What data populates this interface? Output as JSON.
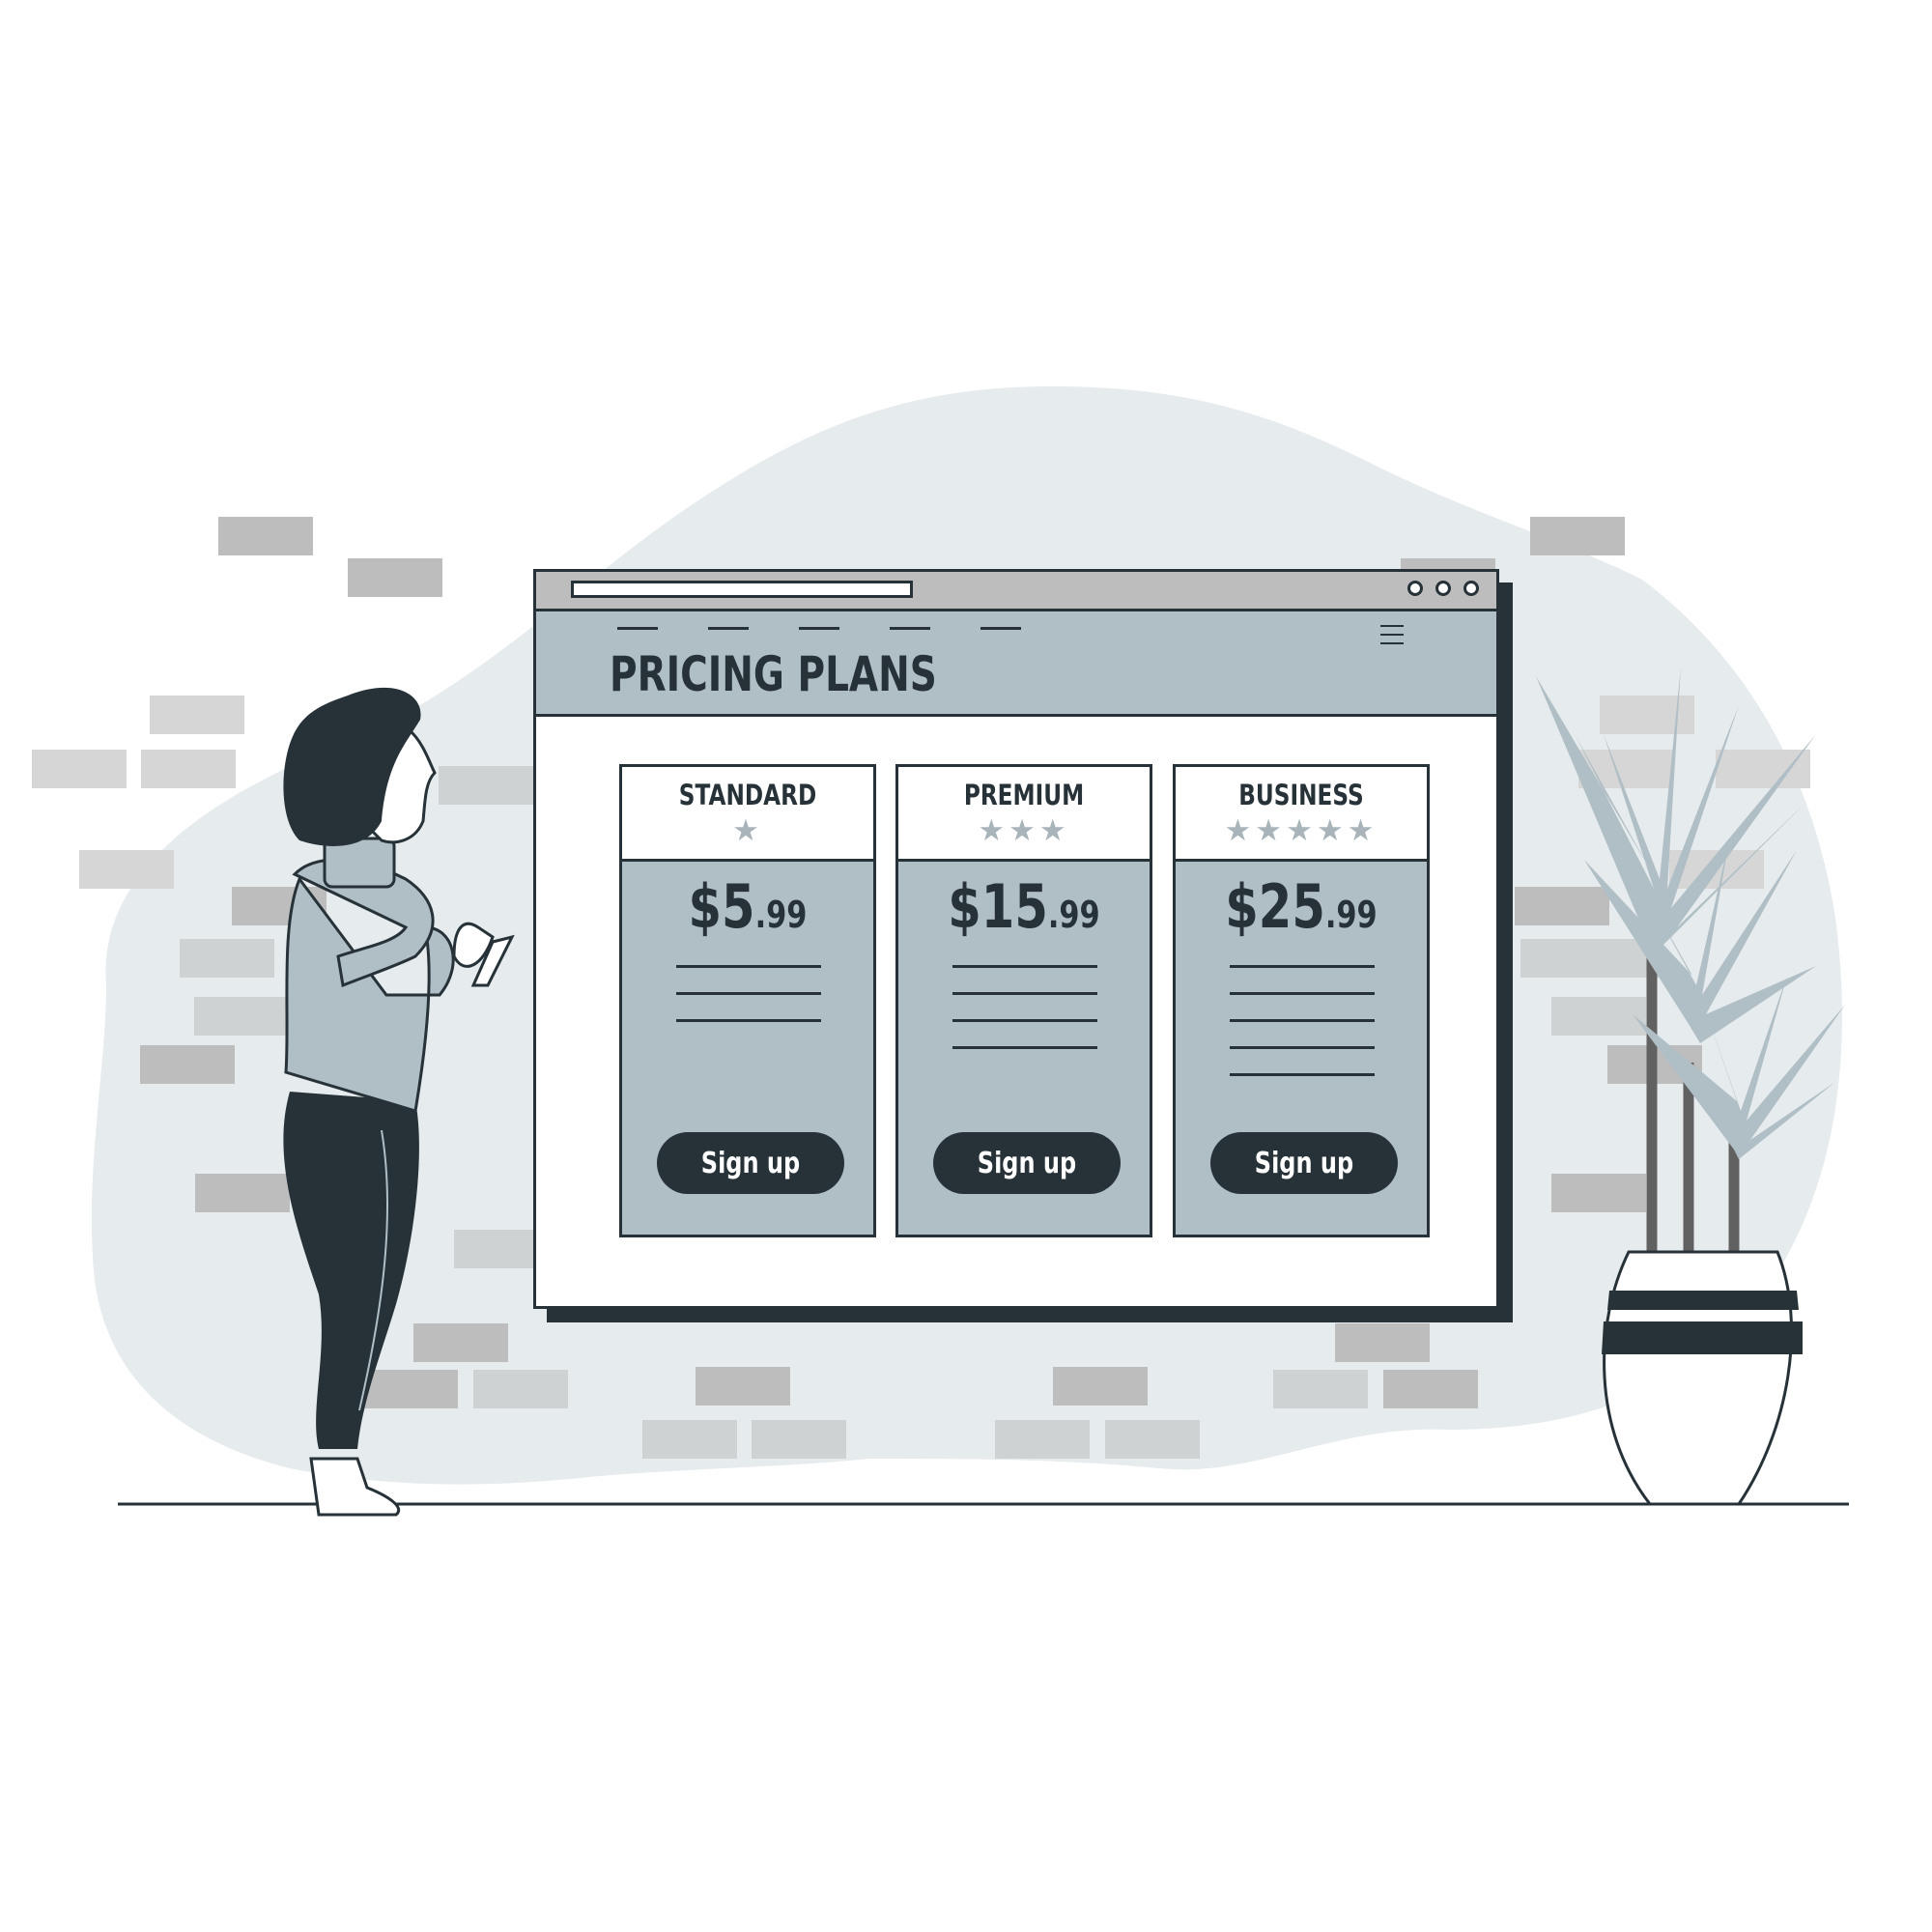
{
  "page": {
    "title": "PRICING PLANS"
  },
  "plans": [
    {
      "name": "STANDARD",
      "stars": "★",
      "rating": 1,
      "price_main": "$5",
      "price_cents": ".99",
      "cta": "Sign up",
      "feature_lines": 3
    },
    {
      "name": "PREMIUM",
      "stars": "★★★",
      "rating": 3,
      "price_main": "$15",
      "price_cents": ".99",
      "cta": "Sign up",
      "feature_lines": 4
    },
    {
      "name": "BUSINESS",
      "stars": "★★★★★",
      "rating": 5,
      "price_main": "$25",
      "price_cents": ".99",
      "cta": "Sign up",
      "feature_lines": 5
    }
  ],
  "colors": {
    "dark": "#263238",
    "accent": "#b0bec5",
    "blob": "#e6ebed",
    "brick": "#bdbdbd"
  },
  "icons": [
    "hamburger-menu-icon",
    "window-dot-icon",
    "star-icon"
  ]
}
